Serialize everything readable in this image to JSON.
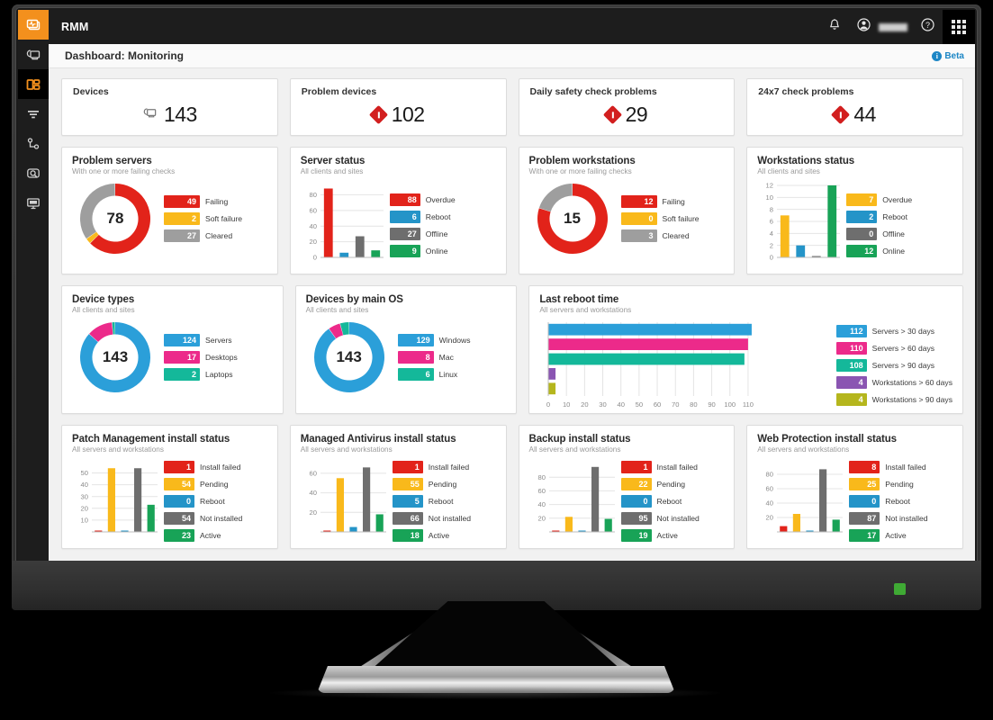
{
  "app": {
    "title": "RMM",
    "page_title": "Dashboard: Monitoring",
    "beta_label": "Beta",
    "beta_icon": "info-icon"
  },
  "sidebar": {
    "items": [
      {
        "icon": "rmm-logo-icon",
        "state": "active-orange"
      },
      {
        "icon": "devices-icon",
        "state": "normal"
      },
      {
        "icon": "dashboard-icon",
        "state": "active-dark"
      },
      {
        "icon": "filter-icon",
        "state": "normal"
      },
      {
        "icon": "topology-icon",
        "state": "normal"
      },
      {
        "icon": "search-monitor-icon",
        "state": "normal"
      },
      {
        "icon": "remote-screen-icon",
        "state": "normal"
      }
    ]
  },
  "topbar": {
    "icons": [
      {
        "name": "notifications-bell-icon"
      },
      {
        "name": "user-account-icon"
      },
      {
        "name": "help-question-icon"
      },
      {
        "name": "app-grid-icon"
      }
    ]
  },
  "kpis": [
    {
      "label": "Devices",
      "value": "143",
      "icon": "devices-icon",
      "icon_type": "device"
    },
    {
      "label": "Problem devices",
      "value": "102",
      "icon": "alert-diamond-icon",
      "icon_type": "alert"
    },
    {
      "label": "Daily safety check problems",
      "value": "29",
      "icon": "alert-diamond-icon",
      "icon_type": "alert"
    },
    {
      "label": "24x7 check problems",
      "value": "44",
      "icon": "alert-diamond-icon",
      "icon_type": "alert"
    }
  ],
  "colors": {
    "red": "#e2231a",
    "amber": "#f9b91b",
    "grey": "#6e6e6e",
    "green": "#18a357",
    "blue": "#2494c8",
    "blue_light": "#2b9fd9",
    "pink": "#ec2a8a",
    "teal": "#14b89a",
    "purple": "#8a55b2",
    "olive": "#b5b61d",
    "accent_orange": "#f3901d",
    "info_blue": "#1c86c5"
  },
  "chart_data": [
    {
      "id": "problem-servers",
      "type": "pie",
      "title": "Problem servers",
      "subtitle": "With one or more failing checks",
      "center_value": "78",
      "labels": [
        "Failing",
        "Soft failure",
        "Cleared"
      ],
      "values": [
        49,
        2,
        27
      ],
      "colors": [
        "#e2231a",
        "#f9b91b",
        "#9e9e9e"
      ],
      "legend": "right"
    },
    {
      "id": "server-status",
      "type": "bar",
      "title": "Server status",
      "subtitle": "All clients and sites",
      "categories": [
        "Overdue",
        "Reboot",
        "Offline",
        "Online"
      ],
      "values": [
        88,
        6,
        27,
        9
      ],
      "colors": [
        "#e2231a",
        "#2494c8",
        "#6e6e6e",
        "#18a357"
      ],
      "yticks": [
        0,
        20,
        40,
        60,
        80
      ],
      "ylim": [
        0,
        92
      ],
      "grid": true,
      "legend": "right"
    },
    {
      "id": "problem-workstations",
      "type": "pie",
      "title": "Problem workstations",
      "subtitle": "With one or more failing checks",
      "center_value": "15",
      "labels": [
        "Failing",
        "Soft failure",
        "Cleared"
      ],
      "values": [
        12,
        0,
        3
      ],
      "colors": [
        "#e2231a",
        "#f9b91b",
        "#9e9e9e"
      ],
      "legend": "right"
    },
    {
      "id": "workstations-status",
      "type": "bar",
      "title": "Workstations status",
      "subtitle": "All clients and sites",
      "categories": [
        "Overdue",
        "Reboot",
        "Offline",
        "Online"
      ],
      "values": [
        7,
        2,
        0,
        12
      ],
      "colors": [
        "#f9b91b",
        "#2494c8",
        "#6e6e6e",
        "#18a357"
      ],
      "yticks": [
        0,
        2,
        4,
        6,
        8,
        10,
        12
      ],
      "ylim": [
        0,
        12
      ],
      "grid": true,
      "legend": "right"
    },
    {
      "id": "device-types",
      "type": "pie",
      "title": "Device types",
      "subtitle": "All clients and sites",
      "center_value": "143",
      "labels": [
        "Servers",
        "Desktops",
        "Laptops"
      ],
      "values": [
        124,
        17,
        2
      ],
      "colors": [
        "#2b9fd9",
        "#ec2a8a",
        "#14b89a"
      ],
      "legend": "right"
    },
    {
      "id": "devices-by-main-os",
      "type": "pie",
      "title": "Devices by main OS",
      "subtitle": "All clients and sites",
      "center_value": "143",
      "labels": [
        "Windows",
        "Mac",
        "Linux"
      ],
      "values": [
        129,
        8,
        6
      ],
      "colors": [
        "#2b9fd9",
        "#ec2a8a",
        "#14b89a"
      ],
      "legend": "right"
    },
    {
      "id": "last-reboot-time",
      "type": "bar",
      "orientation": "horizontal",
      "title": "Last reboot time",
      "subtitle": "All servers and workstations",
      "categories": [
        "Servers > 30 days",
        "Servers > 60 days",
        "Servers > 90 days",
        "Workstations > 60 days",
        "Workstations > 90 days"
      ],
      "values": [
        112,
        110,
        108,
        4,
        4
      ],
      "colors": [
        "#2b9fd9",
        "#ec2a8a",
        "#14b89a",
        "#8a55b2",
        "#b5b61d"
      ],
      "xticks": [
        0,
        10,
        20,
        30,
        40,
        50,
        60,
        70,
        80,
        90,
        100,
        110
      ],
      "xlim": [
        0,
        115
      ],
      "grid": true,
      "legend": "right"
    },
    {
      "id": "patch-management-install-status",
      "type": "bar",
      "title": "Patch Management install status",
      "subtitle": "All servers and workstations",
      "categories": [
        "Install failed",
        "Pending",
        "Reboot",
        "Not installed",
        "Active"
      ],
      "values": [
        1,
        54,
        0,
        54,
        23
      ],
      "colors": [
        "#e2231a",
        "#f9b91b",
        "#2494c8",
        "#6e6e6e",
        "#18a357"
      ],
      "yticks": [
        10,
        20,
        30,
        40,
        50
      ],
      "ylim": [
        0,
        58
      ],
      "grid": true,
      "legend": "right"
    },
    {
      "id": "managed-antivirus-install-status",
      "type": "bar",
      "title": "Managed Antivirus install status",
      "subtitle": "All servers and workstations",
      "categories": [
        "Install failed",
        "Pending",
        "Reboot",
        "Not installed",
        "Active"
      ],
      "values": [
        1,
        55,
        5,
        66,
        18
      ],
      "colors": [
        "#e2231a",
        "#f9b91b",
        "#2494c8",
        "#6e6e6e",
        "#18a357"
      ],
      "yticks": [
        20,
        40,
        60
      ],
      "ylim": [
        0,
        70
      ],
      "grid": true,
      "legend": "right"
    },
    {
      "id": "backup-install-status",
      "type": "bar",
      "title": "Backup install status",
      "subtitle": "All servers and workstations",
      "categories": [
        "Install failed",
        "Pending",
        "Reboot",
        "Not installed",
        "Active"
      ],
      "values": [
        1,
        22,
        0,
        95,
        19
      ],
      "colors": [
        "#e2231a",
        "#f9b91b",
        "#2494c8",
        "#6e6e6e",
        "#18a357"
      ],
      "yticks": [
        20,
        40,
        60,
        80
      ],
      "ylim": [
        0,
        100
      ],
      "grid": true,
      "legend": "right"
    },
    {
      "id": "web-protection-install-status",
      "type": "bar",
      "title": "Web Protection install status",
      "subtitle": "All servers and workstations",
      "categories": [
        "Install failed",
        "Pending",
        "Reboot",
        "Not installed",
        "Active"
      ],
      "values": [
        8,
        25,
        0,
        87,
        17
      ],
      "colors": [
        "#e2231a",
        "#f9b91b",
        "#2494c8",
        "#6e6e6e",
        "#18a357"
      ],
      "yticks": [
        20,
        40,
        60,
        80
      ],
      "ylim": [
        0,
        95
      ],
      "grid": true,
      "legend": "right"
    }
  ]
}
